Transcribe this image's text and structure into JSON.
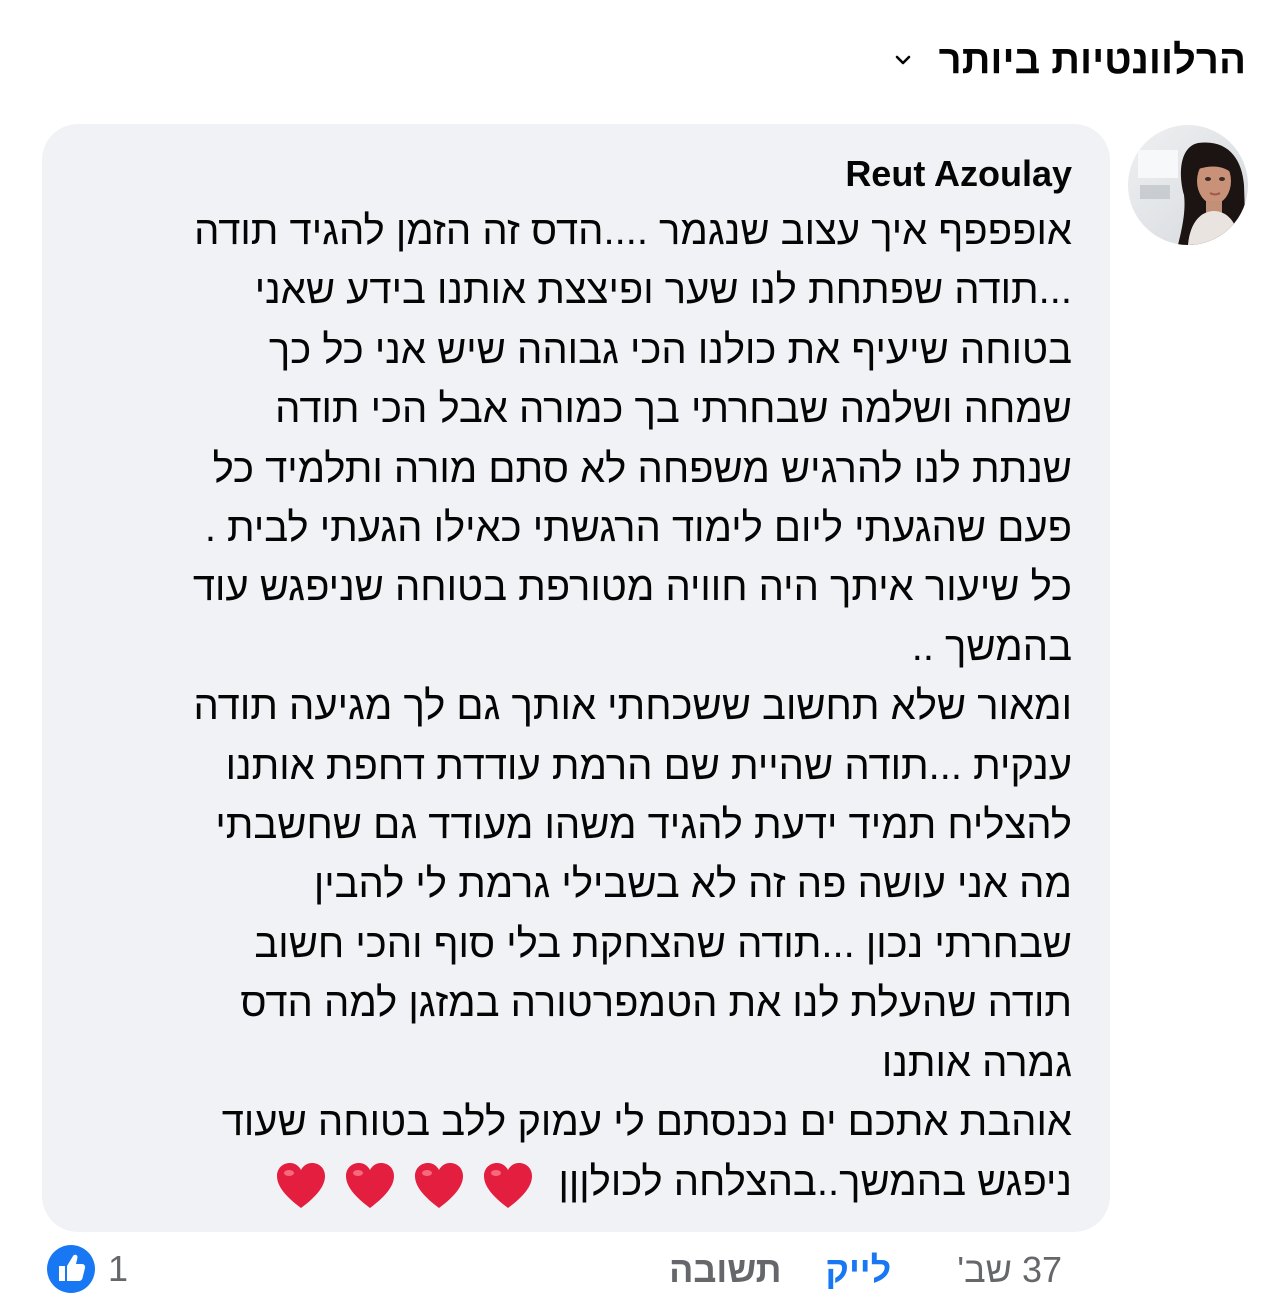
{
  "sort": {
    "label": "הרלוונטיות ביותר",
    "icon": "chevron-down-icon"
  },
  "comment": {
    "author": "Reut Azoulay",
    "avatar_icon": "profile-photo",
    "lines": [
      "אופפפף איך עצוב שנגמר ....הדס זה הזמן להגיד תודה",
      "...תודה שפתחת לנו שער ופיצצת אותנו בידע שאני",
      "בטוחה שיעיף את כולנו הכי גבוהה שיש אני כל כך",
      "שמחה ושלמה שבחרתי בך כמורה אבל הכי תודה",
      "שנתת לנו להרגיש משפחה לא סתם מורה ותלמיד כל",
      "פעם שהגעתי ליום לימוד הרגשתי כאילו הגעתי לבית .",
      "כל שיעור איתך היה חוויה מטורפת בטוחה שניפגש עוד",
      "בהמשך ..",
      "ומאור שלא תחשוב ששכחתי אותך גם לך מגיעה תודה",
      "ענקית ...תודה שהיית שם הרמת עודדת דחפת אותנו",
      "להצליח תמיד ידעת להגיד משהו מעודד גם שחשבתי",
      "מה אני עושה פה זה לא בשבילי גרמת לי להבין",
      "שבחרתי נכון ...תודה שהצחקת בלי סוף והכי חשוב",
      "תודה שהעלת לנו את הטמפרטורה במזגן למה הדס",
      "גמרה אותנו",
      "אוהבת אתכם ים נכנסתם לי עמוק ללב בטוחה שעוד",
      "ניפגש בהמשך..בהצלחה לכולןןן"
    ],
    "hearts": [
      "❤️",
      "❤️",
      "❤️",
      "❤️"
    ],
    "heart_color": "#e41e3f"
  },
  "footer": {
    "time": "37 שב'",
    "like_label": "לייק",
    "reply_label": "תשובה"
  },
  "reactions": {
    "icon": "like-reaction-icon",
    "count": "1",
    "color": "#1877f2"
  }
}
